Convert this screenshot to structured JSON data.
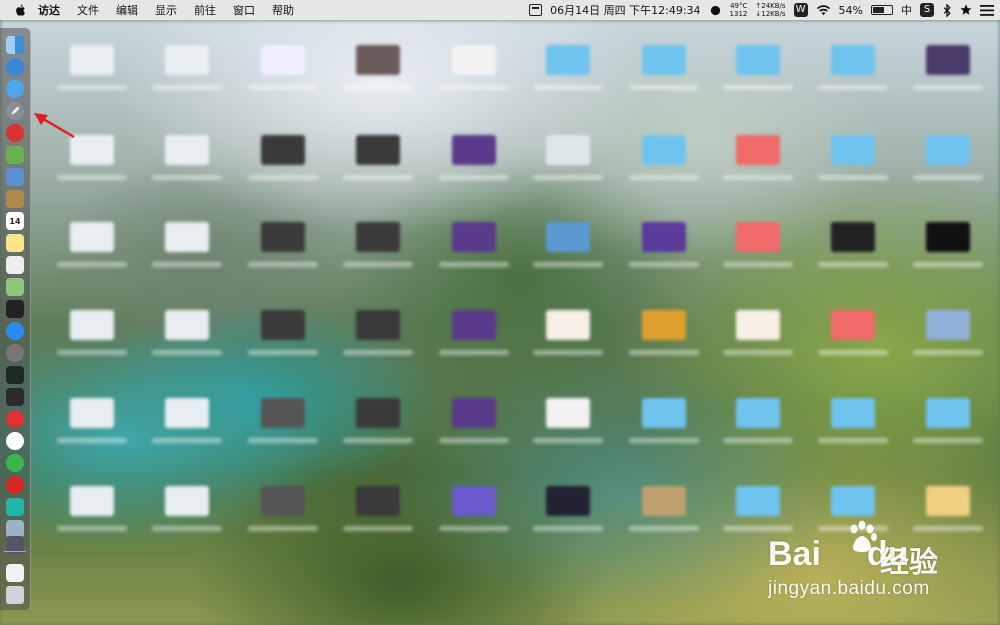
{
  "menubar": {
    "items": [
      "访达",
      "文件",
      "编辑",
      "显示",
      "前往",
      "窗口",
      "帮助"
    ],
    "datetime": "06月14日 周四 下午12:49:34",
    "temp_top": "49°C",
    "temp_bottom": "1312",
    "net_up": "↑24KB/s",
    "net_down": "↓12KB/s",
    "battery": "54%",
    "input_method": "中"
  },
  "dock": {
    "icons": [
      "finder-icon",
      "safari-icon",
      "safari-compass-icon",
      "launchpad-rocket-icon",
      "app-red-icon",
      "android-icon",
      "preview-icon",
      "notes-brown-icon",
      "calendar-icon",
      "notes-icon",
      "textedit-icon",
      "maps-icon",
      "terminal-green-icon",
      "app-store-icon",
      "system-preferences-icon",
      "activity-monitor-icon",
      "terminal-icon",
      "vivaldi-icon",
      "yandex-icon",
      "wechat-icon",
      "netease-music-icon",
      "teal-app-icon",
      "photos-icon",
      "screenshot-icon",
      "document-icon",
      "trash-icon"
    ],
    "calendar_day": "14"
  },
  "watermark": {
    "brand": "Bai",
    "brand_tail": "du",
    "brand_cn": "经验",
    "url": "jingyan.baidu.com"
  },
  "colors": {
    "annotation_arrow": "#e02020",
    "folder_blue": "#6fc3ef",
    "folder_red": "#f06a6a"
  }
}
